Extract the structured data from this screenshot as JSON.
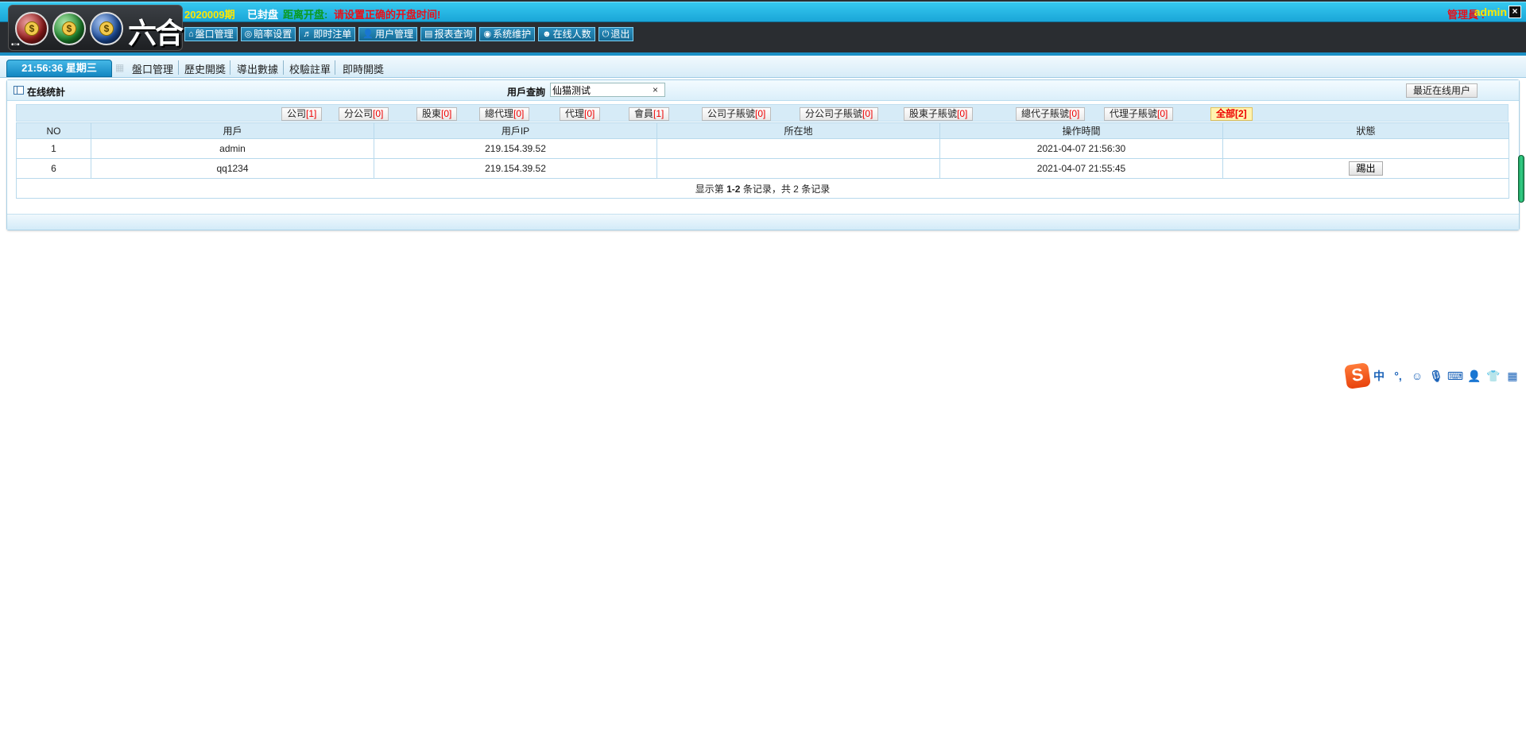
{
  "header": {
    "logo_text": "六合",
    "logo_ball_symbol": "$",
    "period": "2020009期",
    "status_sealed": "已封盘",
    "open_label": "距离开盘:",
    "open_warning": "请设置正确的开盘时间!",
    "admin_label": "管理員 :",
    "admin_name": "admin",
    "close_symbol": "×",
    "nav": [
      {
        "icon": "⌂",
        "label": "盤口管理"
      },
      {
        "icon": "◎",
        "label": "賠率设置"
      },
      {
        "icon": "♬",
        "label": "即时注单"
      },
      {
        "icon": "👤",
        "label": "用户管理"
      },
      {
        "icon": "▤",
        "label": "报表查询"
      },
      {
        "icon": "◉",
        "label": "系统维护"
      },
      {
        "icon": "☻",
        "label": "在线人数"
      },
      {
        "icon": "⏻",
        "label": "退出"
      }
    ]
  },
  "tabbar": {
    "clock": "21:56:36 星期三",
    "tabs": [
      "盤口管理",
      "歷史開獎",
      "導出數據",
      "校驗註單",
      "即時開獎"
    ]
  },
  "panel": {
    "title": "在线统計",
    "search_label": "用戶查詢",
    "search_value": "仙猫测试",
    "search_clear": "×",
    "recent_button": "最近在线用户",
    "filters": [
      {
        "label": "公司",
        "count": "[1]"
      },
      {
        "label": "分公司",
        "count": "[0]"
      },
      {
        "label": "股東",
        "count": "[0]"
      },
      {
        "label": "總代理",
        "count": "[0]"
      },
      {
        "label": "代理",
        "count": "[0]"
      },
      {
        "label": "會員",
        "count": "[1]"
      },
      {
        "label": "公司子賬號",
        "count": "[0]"
      },
      {
        "label": "分公司子賬號",
        "count": "[0]"
      },
      {
        "label": "股東子賬號",
        "count": "[0]"
      },
      {
        "label": "總代子賬號",
        "count": "[0]"
      },
      {
        "label": "代理子賬號",
        "count": "[0]"
      },
      {
        "label": "全部",
        "count": "[2]"
      }
    ],
    "table": {
      "headers": [
        "NO",
        "用戶",
        "用戶IP",
        "所在地",
        "操作時間",
        "狀態"
      ],
      "rows": [
        {
          "no": "1",
          "user": "admin",
          "ip": "219.154.39.52",
          "location": "",
          "time": "2021-04-07 21:56:30",
          "action": ""
        },
        {
          "no": "6",
          "user": "qq1234",
          "ip": "219.154.39.52",
          "location": "",
          "time": "2021-04-07 21:55:45",
          "action": "踢出"
        }
      ],
      "footer_prefix": "显示第",
      "footer_range": "1-2",
      "footer_middle": "条记录，共",
      "footer_total": "2",
      "footer_suffix": "条记录"
    }
  },
  "ime": {
    "logo": "S",
    "items": [
      {
        "icon": "chinese-mode-icon",
        "text": "中"
      },
      {
        "icon": "punctuation-icon",
        "text": "°,"
      },
      {
        "icon": "emoji-icon",
        "text": "☺"
      },
      {
        "icon": "microphone-icon",
        "text": "🎙"
      },
      {
        "icon": "keyboard-icon",
        "text": "⌨"
      },
      {
        "icon": "user-icon",
        "text": "👤"
      },
      {
        "icon": "skin-icon",
        "text": "👕"
      },
      {
        "icon": "toolbox-icon",
        "text": "▦"
      }
    ]
  }
}
